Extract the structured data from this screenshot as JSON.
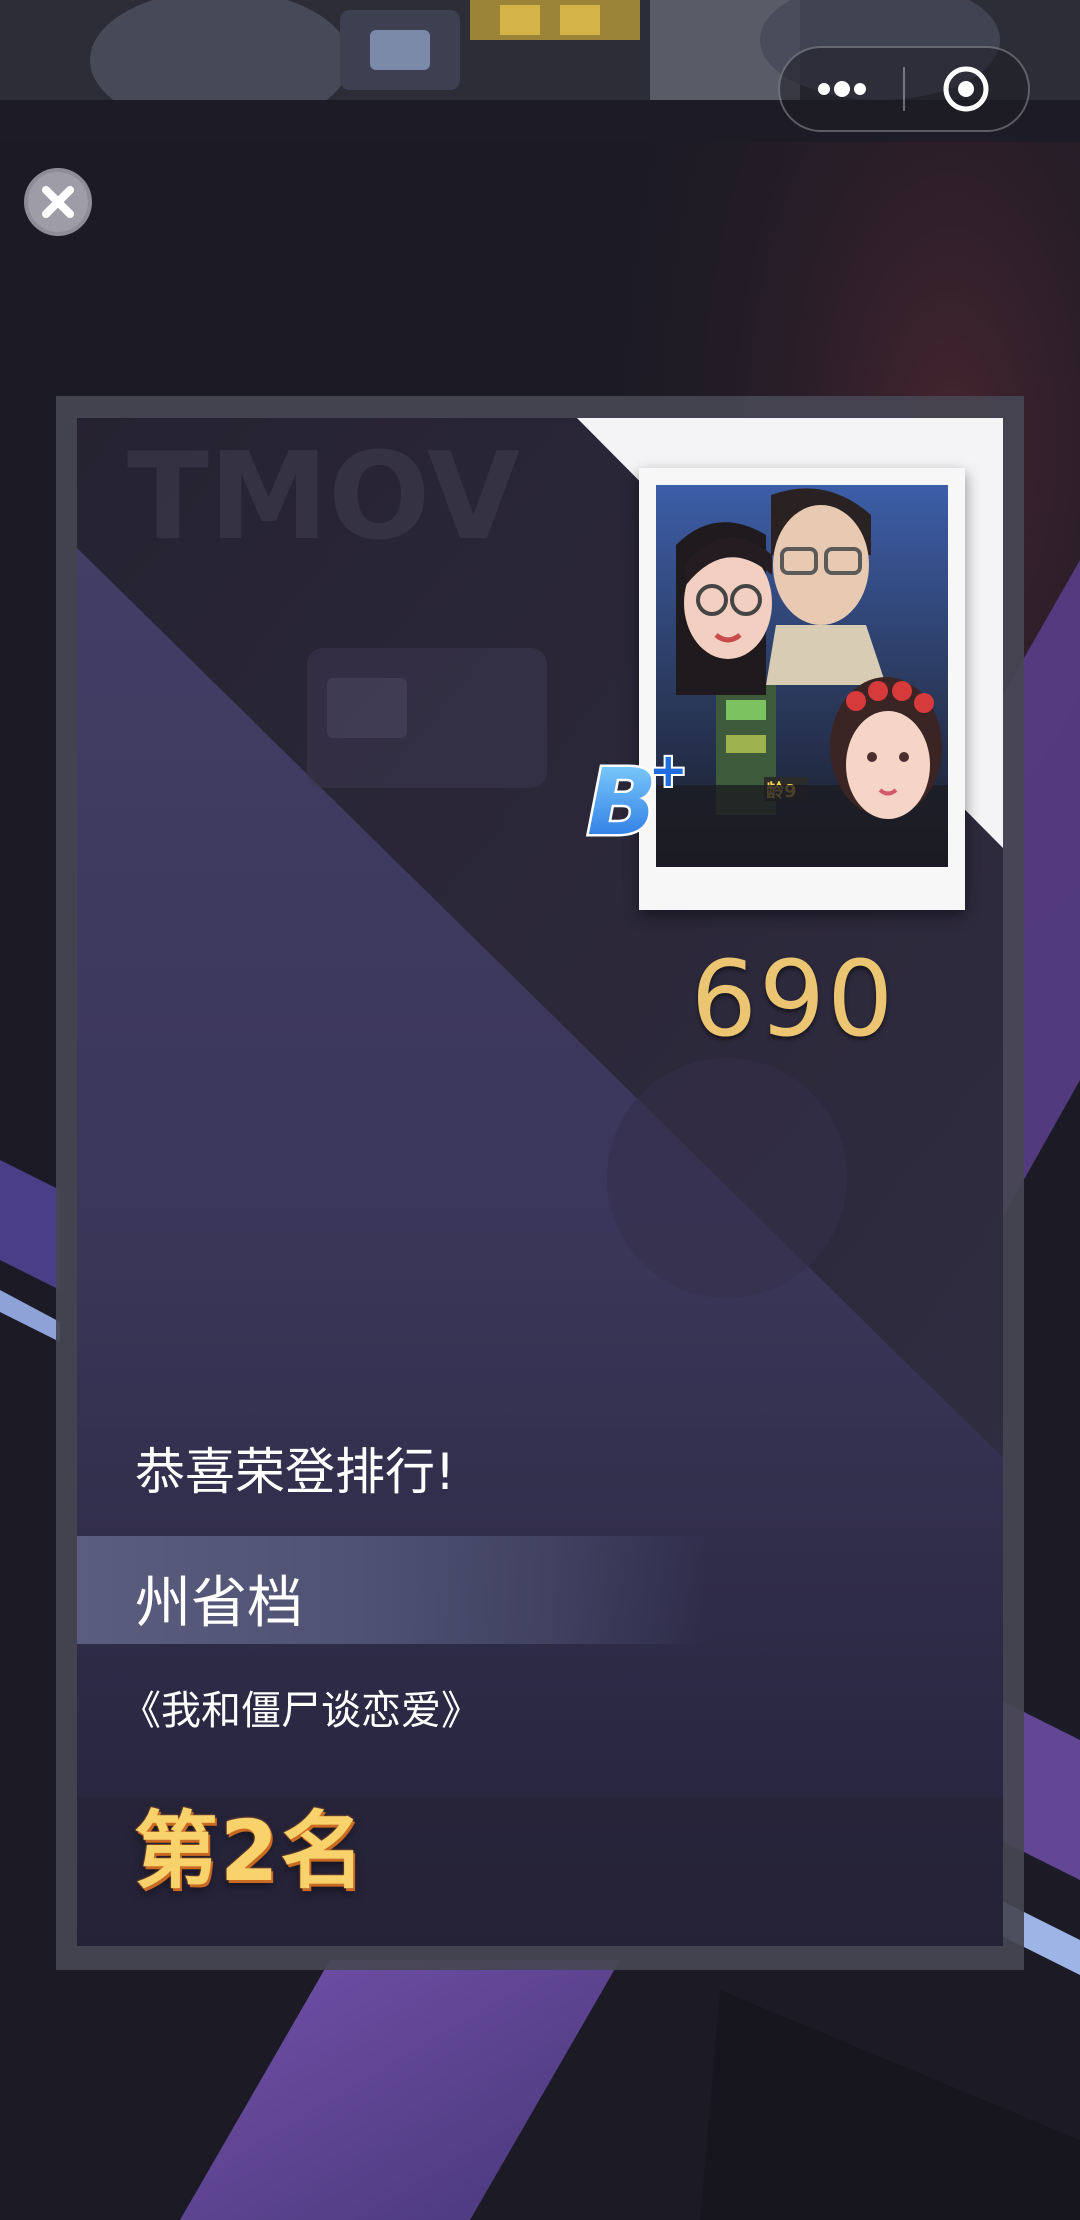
{
  "capsule": {
    "more_icon": "more-dots-icon",
    "target_icon": "target-circle-icon"
  },
  "close_button": {
    "icon": "close-x-icon"
  },
  "card": {
    "grade": "B",
    "grade_modifier": "+",
    "score": "690",
    "congrats": "恭喜荣登排行!",
    "category": "州省档",
    "movie_title": "《我和僵尸谈恋爱》",
    "rank": "第2名"
  },
  "colors": {
    "background": "#1b1a24",
    "panel": "#3b3858",
    "score": "#ecc572",
    "rank": "#f8d36c",
    "accent_purple": "#6b4ea0"
  }
}
